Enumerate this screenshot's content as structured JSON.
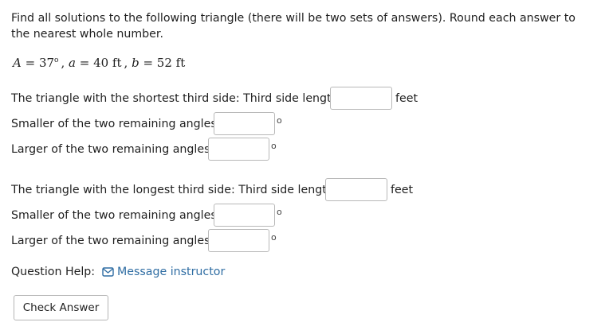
{
  "prompt": "Find all solutions to the following triangle (there will be two sets of answers). Round each answer to the nearest whole number.",
  "given": {
    "A_label": "A",
    "A_value": "37",
    "A_unit": "o",
    "a_label": "a",
    "a_value": "40 ft",
    "b_label": "b",
    "b_value": "52 ft"
  },
  "set1": {
    "third_side_label": "The triangle with the shortest third side: Third side length:",
    "third_side_value": "",
    "unit": "feet",
    "smaller_angle_label": "Smaller of the two remaining angles:",
    "smaller_angle_value": "",
    "larger_angle_label": "Larger of the two remaining angles:",
    "larger_angle_value": "",
    "degree_symbol": "o"
  },
  "set2": {
    "third_side_label": "The triangle with the longest third side: Third side length:",
    "third_side_value": "",
    "unit": "feet",
    "smaller_angle_label": "Smaller of the two remaining angles:",
    "smaller_angle_value": "",
    "larger_angle_label": "Larger of the two remaining angles:",
    "larger_angle_value": "",
    "degree_symbol": "o"
  },
  "help": {
    "label": "Question Help:",
    "icon": "mail-icon",
    "link_text": "Message instructor"
  },
  "check_answer_label": "Check Answer",
  "colors": {
    "link": "#2f6da3",
    "border": "#b8b8b8",
    "text": "#1f1f1f"
  }
}
